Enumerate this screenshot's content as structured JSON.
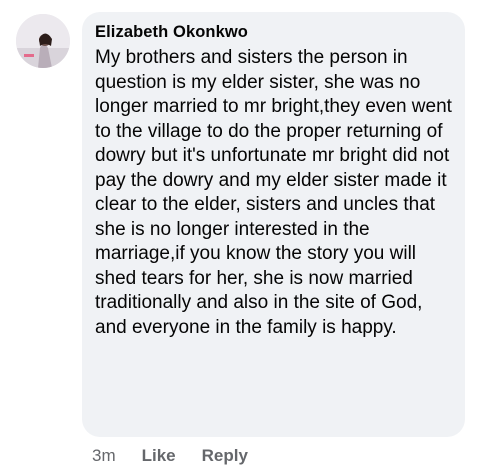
{
  "comment": {
    "author": "Elizabeth Okonkwo",
    "text": "My brothers and sisters the person in question is my elder sister, she was no longer married to mr bright,they even went to the village to do the proper returning of dowry but it's unfortunate mr bright did not pay the dowry and my elder sister made it clear to the elder, sisters and uncles that she is no longer interested in the marriage,if you know the story you will shed tears for her, she is now married traditionally and also in the site of God, and everyone in the family is happy."
  },
  "actions": {
    "time": "3m",
    "like_label": "Like",
    "reply_label": "Reply"
  },
  "colors": {
    "bubble_bg": "#f0f2f5",
    "action_text": "#65676b"
  }
}
